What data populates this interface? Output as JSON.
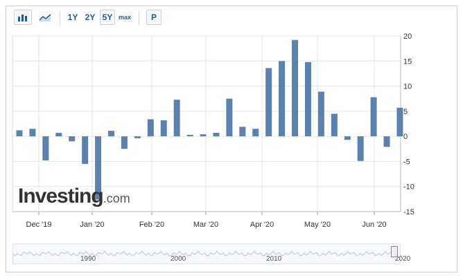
{
  "toolbar": {
    "bar_chart_icon": "bar-chart-icon",
    "area_chart_icon": "area-chart-icon",
    "range_1y": "1Y",
    "range_2y": "2Y",
    "range_5y": "5Y",
    "range_max": "max",
    "p_button": "P"
  },
  "logo": {
    "main": "Investing",
    "suffix": ".com"
  },
  "colors": {
    "bar": "#5b82ad",
    "grid": "#e6e6e6",
    "selected_bar": "#a9c0d8"
  },
  "chart_data": {
    "type": "bar",
    "y_ticks": [
      "20",
      "15",
      "10",
      "5",
      "0",
      "-5",
      "-10",
      "-15"
    ],
    "ylim": [
      -15,
      20
    ],
    "x_tick_labels": [
      "Dec '19",
      "Jan '20",
      "Feb '20",
      "Mar '20",
      "Apr '20",
      "May '20",
      "Jun '20"
    ],
    "values": [
      1.2,
      1.5,
      -4.8,
      0.7,
      -1.0,
      -5.5,
      -12.6,
      1.1,
      -2.5,
      -0.4,
      3.4,
      3.2,
      7.3,
      0.3,
      0.4,
      0.7,
      7.5,
      1.9,
      1.5,
      13.6,
      15.0,
      19.2,
      14.8,
      8.9,
      4.5,
      -0.7,
      -4.9,
      7.8,
      -2.1,
      5.7
    ],
    "grid": true
  },
  "navigator": {
    "labels": [
      "1990",
      "2000",
      "2010",
      "2020"
    ]
  }
}
